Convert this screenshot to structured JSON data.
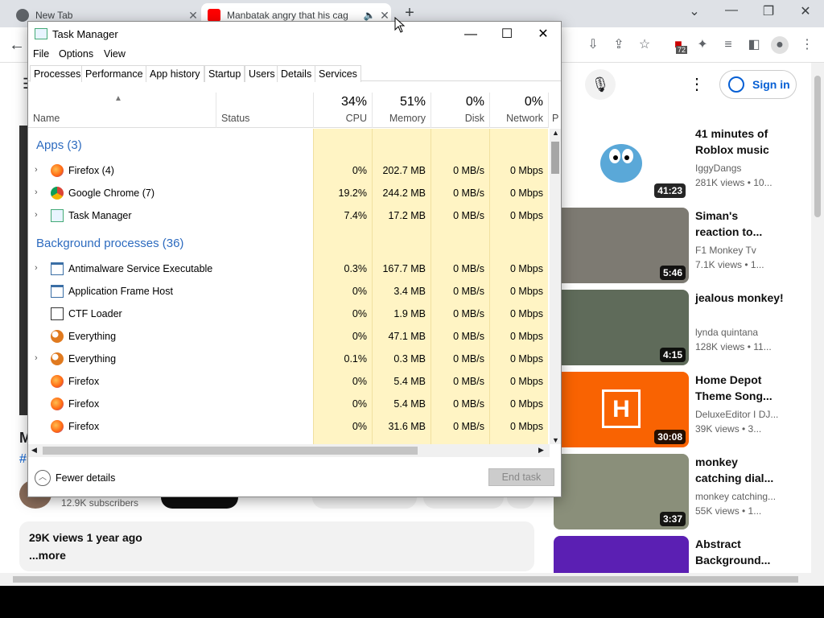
{
  "browser": {
    "tabs": [
      {
        "title": "New Tab"
      },
      {
        "title": "Manbatak angry that his cag"
      }
    ],
    "extension_badge": "72"
  },
  "youtube": {
    "sign_in": "Sign in",
    "channel_subscribers": "12.9K subscribers",
    "description_views": "29K views  1 year ago",
    "description_more": "...more",
    "recommendations": [
      {
        "title": "41 minutes of Roblox music",
        "channel": "IggyDangs",
        "views": "281K views  • 10...",
        "duration": "41:23"
      },
      {
        "title": "Siman's reaction to...",
        "channel": "F1 Monkey Tv",
        "views": "7.1K views  • 1...",
        "duration": "5:46"
      },
      {
        "title": "jealous monkey!",
        "channel": "lynda quintana",
        "views": "128K views  • 11...",
        "duration": "4:15"
      },
      {
        "title": "Home Depot Theme Song...",
        "channel": "DeluxeEditor I DJ...",
        "views": "39K views  • 3...",
        "duration": "30:08"
      },
      {
        "title": "monkey catching dial...",
        "channel": "monkey catching...",
        "views": "55K views  • 1...",
        "duration": "3:37"
      },
      {
        "title": "Abstract Background...",
        "channel": "",
        "views": "",
        "duration": ""
      }
    ]
  },
  "taskmanager": {
    "title": "Task Manager",
    "menu": [
      "File",
      "Options",
      "View"
    ],
    "tabs": [
      "Processes",
      "Performance",
      "App history",
      "Startup",
      "Users",
      "Details",
      "Services"
    ],
    "columns": {
      "name": "Name",
      "status": "Status",
      "cpu": {
        "pct": "34%",
        "label": "CPU"
      },
      "memory": {
        "pct": "51%",
        "label": "Memory"
      },
      "disk": {
        "pct": "0%",
        "label": "Disk"
      },
      "network": {
        "pct": "0%",
        "label": "Network"
      },
      "power": "P"
    },
    "groups": {
      "apps": "Apps (3)",
      "background": "Background processes (36)"
    },
    "apps": [
      {
        "name": "Firefox (4)",
        "cpu": "0%",
        "memory": "202.7 MB",
        "disk": "0 MB/s",
        "network": "0 Mbps",
        "icon": "firefox-icon"
      },
      {
        "name": "Google Chrome (7)",
        "cpu": "19.2%",
        "memory": "244.2 MB",
        "disk": "0 MB/s",
        "network": "0 Mbps",
        "icon": "chrome-icon"
      },
      {
        "name": "Task Manager",
        "cpu": "7.4%",
        "memory": "17.2 MB",
        "disk": "0 MB/s",
        "network": "0 Mbps",
        "icon": "taskmanager-icon"
      }
    ],
    "background": [
      {
        "name": "Antimalware Service Executable",
        "cpu": "0.3%",
        "memory": "167.7 MB",
        "disk": "0 MB/s",
        "network": "0 Mbps"
      },
      {
        "name": "Application Frame Host",
        "cpu": "0%",
        "memory": "3.4 MB",
        "disk": "0 MB/s",
        "network": "0 Mbps"
      },
      {
        "name": "CTF Loader",
        "cpu": "0%",
        "memory": "1.9 MB",
        "disk": "0 MB/s",
        "network": "0 Mbps"
      },
      {
        "name": "Everything",
        "cpu": "0%",
        "memory": "47.1 MB",
        "disk": "0 MB/s",
        "network": "0 Mbps"
      },
      {
        "name": "Everything",
        "cpu": "0.1%",
        "memory": "0.3 MB",
        "disk": "0 MB/s",
        "network": "0 Mbps"
      },
      {
        "name": "Firefox",
        "cpu": "0%",
        "memory": "5.4 MB",
        "disk": "0 MB/s",
        "network": "0 Mbps"
      },
      {
        "name": "Firefox",
        "cpu": "0%",
        "memory": "5.4 MB",
        "disk": "0 MB/s",
        "network": "0 Mbps"
      },
      {
        "name": "Firefox",
        "cpu": "0%",
        "memory": "31.6 MB",
        "disk": "0 MB/s",
        "network": "0 Mbps"
      }
    ],
    "fewer_details": "Fewer details",
    "end_task": "End task"
  }
}
